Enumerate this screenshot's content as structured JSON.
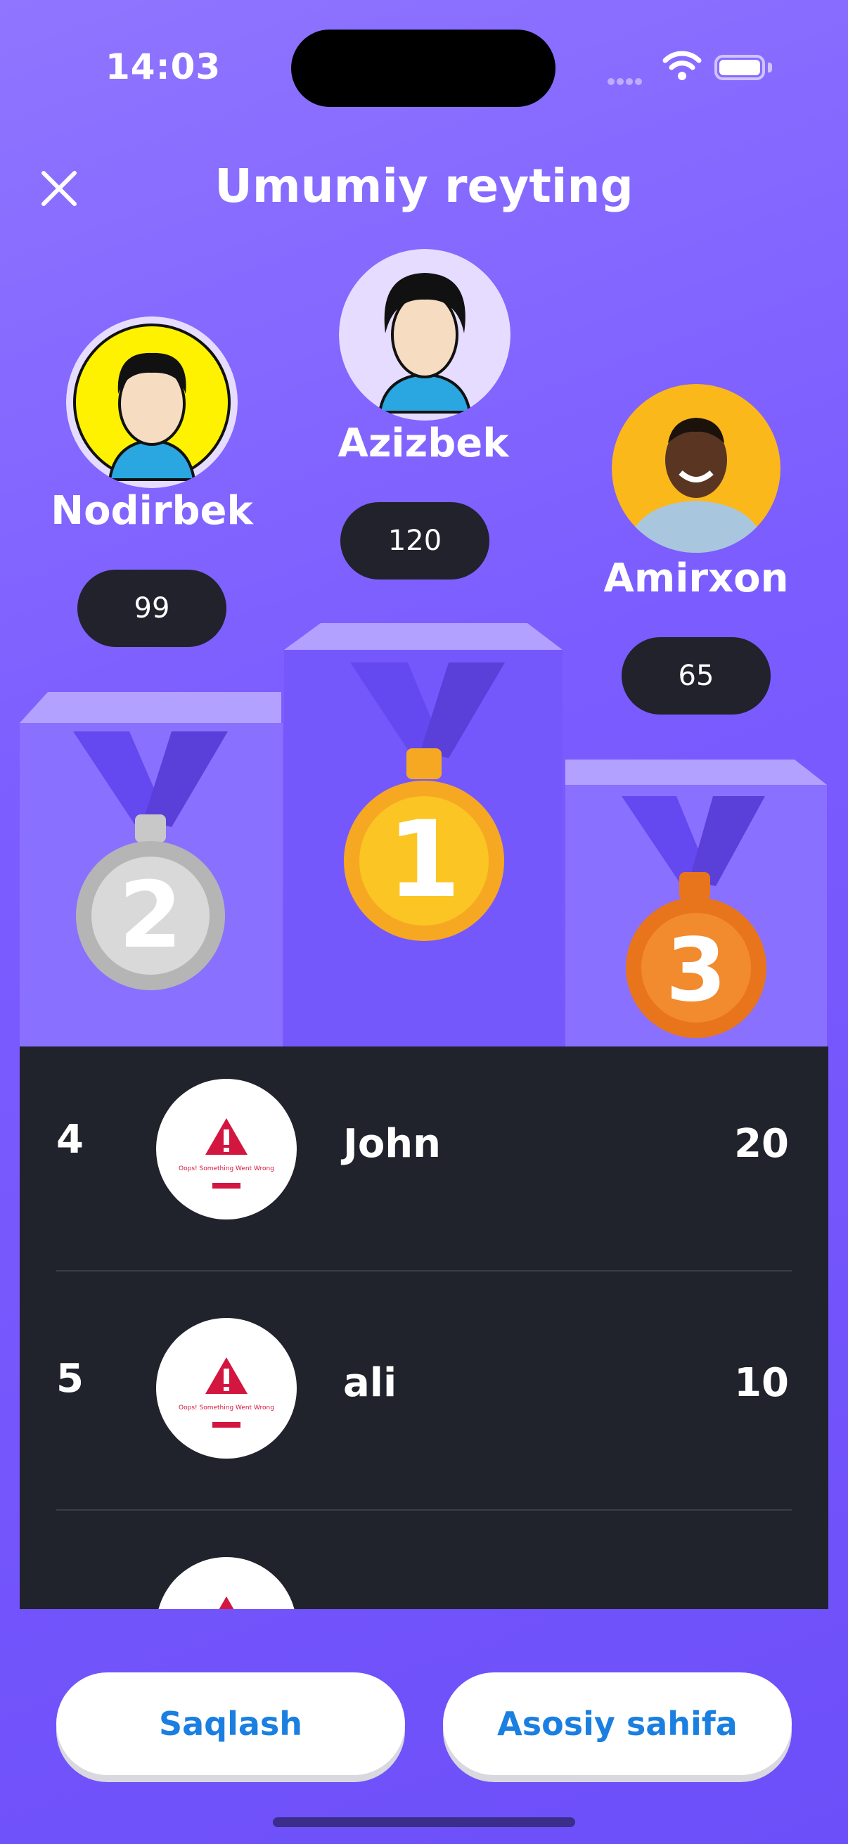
{
  "status_bar": {
    "time": "14:03"
  },
  "header": {
    "title": "Umumiy reyting"
  },
  "podium": {
    "first": {
      "name": "Azizbek",
      "score": "120",
      "medal": "1"
    },
    "second": {
      "name": "Nodirbek",
      "score": "99",
      "medal": "2"
    },
    "third": {
      "name": "Amirxon",
      "score": "65",
      "medal": "3"
    }
  },
  "leaderboard": {
    "rows": [
      {
        "rank": "4",
        "name": "John",
        "score": "20",
        "avatar_caption": "Oops! Something Went Wrong"
      },
      {
        "rank": "5",
        "name": "ali",
        "score": "10",
        "avatar_caption": "Oops! Something Went Wrong"
      }
    ]
  },
  "buttons": {
    "save": "Saqlash",
    "home": "Asosiy sahifa"
  },
  "colors": {
    "background": "#7b5cff",
    "board": "#20232b",
    "gold": "#fbbf24",
    "silver": "#c8c8c8",
    "bronze": "#f28a2e",
    "button_text": "#1a7fe0"
  }
}
